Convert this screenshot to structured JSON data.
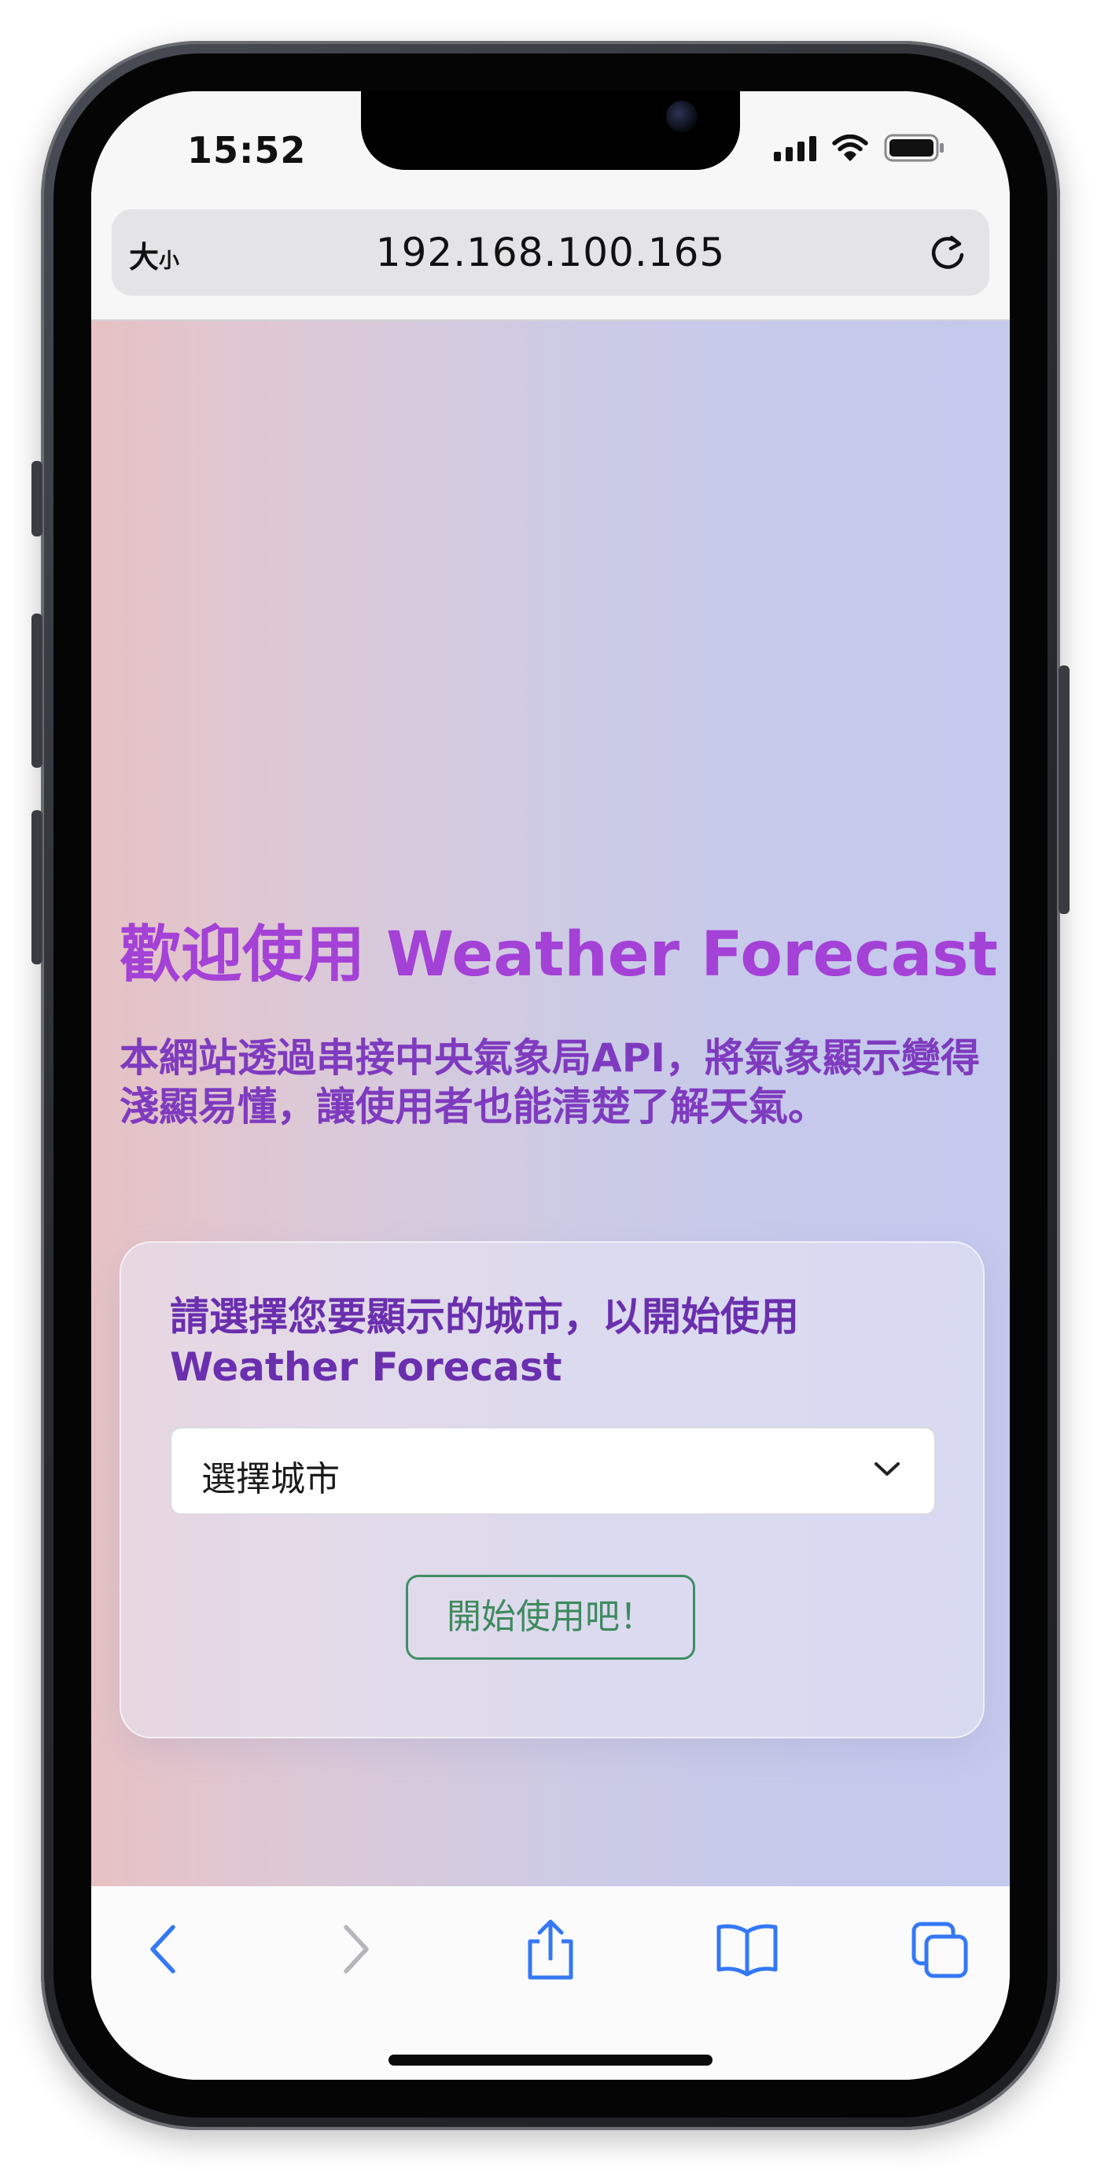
{
  "status_bar": {
    "time": "15:52"
  },
  "browser": {
    "text_size_label_large": "大",
    "text_size_label_small": "小",
    "url": "192.168.100.165"
  },
  "page": {
    "title": "歡迎使用 Weather Forecast",
    "description": "本網站透過串接中央氣象局API，將氣象顯示變得淺顯易懂，讓使用者也能清楚了解天氣。",
    "card": {
      "prompt": "請選擇您要顯示的城市，以開始使用 Weather Forecast",
      "city_select_value": "選擇城市",
      "start_button_label": "開始使用吧！"
    }
  },
  "toolbar": {
    "icons": [
      "back-icon",
      "forward-icon",
      "share-icon",
      "bookmarks-icon",
      "tabs-icon"
    ]
  },
  "colors": {
    "title": "#a441d6",
    "description": "#7f3bbf",
    "card_title": "#6a2fae",
    "start_button": "#3f8f63",
    "toolbar_accent": "#3478f6"
  }
}
